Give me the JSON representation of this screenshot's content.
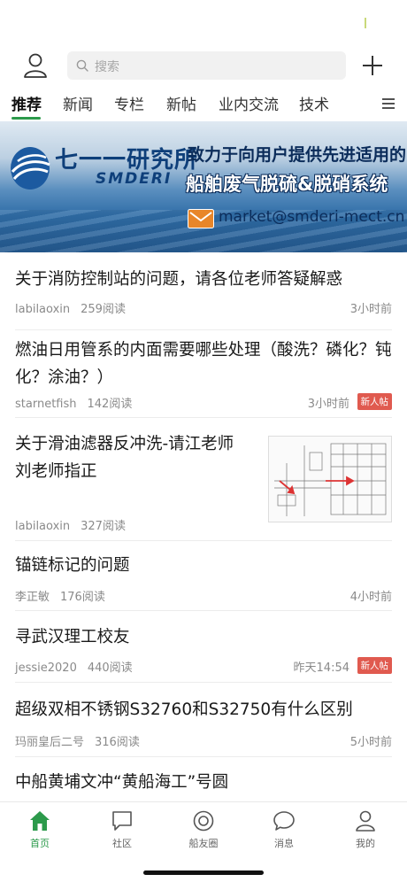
{
  "search": {
    "placeholder": "搜索"
  },
  "tabs": [
    {
      "label": "推荐",
      "active": true
    },
    {
      "label": "新闻"
    },
    {
      "label": "专栏"
    },
    {
      "label": "新帖"
    },
    {
      "label": "业内交流"
    },
    {
      "label": "技术"
    }
  ],
  "banner": {
    "logo_cn": "七一一研究所",
    "logo_en": "SMDERI",
    "slogan_line1": "致力于向用户提供先进适用的",
    "slogan_line2": "船舶废气脱硫&脱硝系统",
    "email": "market@smderi-mect.cn"
  },
  "feed": [
    {
      "title": "关于消防控制站的问题，请各位老师答疑解惑",
      "author": "labilaoxin",
      "reads": "259阅读",
      "time": "3小时前"
    },
    {
      "title": "燃油日用管系的内面需要哪些处理（酸洗？磷化？钝化？涂油？）",
      "author": "starnetfish",
      "reads": "142阅读",
      "time": "3小时前",
      "badge": "新人帖"
    },
    {
      "title": "关于滑油滤器反冲洗-请江老师刘老师指正",
      "author": "labilaoxin",
      "reads": "327阅读",
      "time": ""
    },
    {
      "title": "锚链标记的问题",
      "author": "李正敏",
      "reads": "176阅读",
      "time": "4小时前"
    },
    {
      "title": "寻武汉理工校友",
      "author": "jessie2020",
      "reads": "440阅读",
      "time": "昨天14:54",
      "badge": "新人帖"
    },
    {
      "title": "超级双相不锈钢S32760和S32750有什么区别",
      "author": "玛丽皇后二号",
      "reads": "316阅读",
      "time": "5小时前"
    },
    {
      "title": "中船黄埔文冲“黄船海工”号圆",
      "author": "",
      "reads": "",
      "time": ""
    }
  ],
  "bottom_nav": [
    {
      "label": "首页",
      "icon": "home-icon",
      "active": true
    },
    {
      "label": "社区",
      "icon": "chat-square-icon"
    },
    {
      "label": "船友圈",
      "icon": "compass-icon"
    },
    {
      "label": "消息",
      "icon": "message-bubble-icon"
    },
    {
      "label": "我的",
      "icon": "user-icon"
    }
  ],
  "colors": {
    "accent": "#2c9a4b",
    "badge": "#e05a4f"
  }
}
